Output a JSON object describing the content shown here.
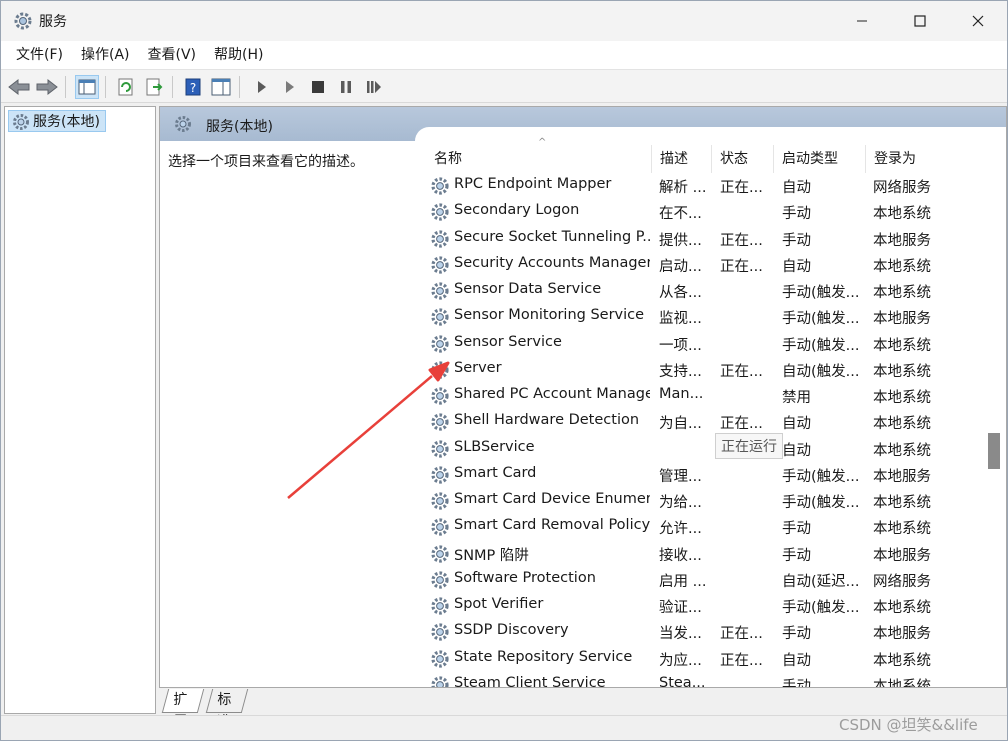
{
  "window": {
    "title": "服务"
  },
  "menubar": {
    "items": [
      "文件(F)",
      "操作(A)",
      "查看(V)",
      "帮助(H)"
    ]
  },
  "toolbar": {
    "icons": [
      "back-arrow-icon",
      "forward-arrow-icon",
      "show-tree-icon",
      "refresh-icon",
      "export-icon",
      "help-icon",
      "properties-icon",
      "start-service-icon",
      "start-service-alt-icon",
      "stop-service-icon",
      "pause-service-icon",
      "restart-service-icon"
    ]
  },
  "tree": {
    "selected_label": "服务(本地)"
  },
  "pane": {
    "header": "服务(本地)",
    "description": "选择一个项目来查看它的描述。"
  },
  "columns": [
    "名称",
    "描述",
    "状态",
    "启动类型",
    "登录为"
  ],
  "services": [
    [
      "RPC Endpoint Mapper",
      "解析 ...",
      "正在...",
      "自动",
      "网络服务"
    ],
    [
      "Secondary Logon",
      "在不...",
      "",
      "手动",
      "本地系统"
    ],
    [
      "Secure Socket Tunneling P...",
      "提供...",
      "正在...",
      "手动",
      "本地服务"
    ],
    [
      "Security Accounts Manager",
      "启动...",
      "正在...",
      "自动",
      "本地系统"
    ],
    [
      "Sensor Data Service",
      "从各...",
      "",
      "手动(触发...",
      "本地系统"
    ],
    [
      "Sensor Monitoring Service",
      "监视...",
      "",
      "手动(触发...",
      "本地服务"
    ],
    [
      "Sensor Service",
      "一项...",
      "",
      "手动(触发...",
      "本地系统"
    ],
    [
      "Server",
      "支持...",
      "正在...",
      "自动(触发...",
      "本地系统"
    ],
    [
      "Shared PC Account Manager",
      "Man...",
      "",
      "禁用",
      "本地系统"
    ],
    [
      "Shell Hardware Detection",
      "为自...",
      "正在...",
      "自动",
      "本地系统"
    ],
    [
      "SLBService",
      "",
      "",
      "自动",
      "本地系统"
    ],
    [
      "Smart Card",
      "管理...",
      "",
      "手动(触发...",
      "本地服务"
    ],
    [
      "Smart Card Device Enumer...",
      "为给...",
      "",
      "手动(触发...",
      "本地系统"
    ],
    [
      "Smart Card Removal Policy",
      "允许...",
      "",
      "手动",
      "本地系统"
    ],
    [
      "SNMP 陷阱",
      "接收...",
      "",
      "手动",
      "本地服务"
    ],
    [
      "Software Protection",
      "启用 ...",
      "",
      "自动(延迟...",
      "网络服务"
    ],
    [
      "Spot Verifier",
      "验证...",
      "",
      "手动(触发...",
      "本地系统"
    ],
    [
      "SSDP Discovery",
      "当发...",
      "正在...",
      "手动",
      "本地服务"
    ],
    [
      "State Repository Service",
      "为应...",
      "正在...",
      "自动",
      "本地系统"
    ],
    [
      "Steam Client Service",
      "Stea...",
      "",
      "手动",
      "本地系统"
    ]
  ],
  "tooltip": "正在运行",
  "bottom_tabs": [
    "扩展",
    "标准"
  ],
  "watermark": "CSDN @坦笑&&life",
  "colors": {
    "accent": "#cce4f7",
    "pane_header": "#b0c2d8",
    "arrow": "#e8403a"
  }
}
